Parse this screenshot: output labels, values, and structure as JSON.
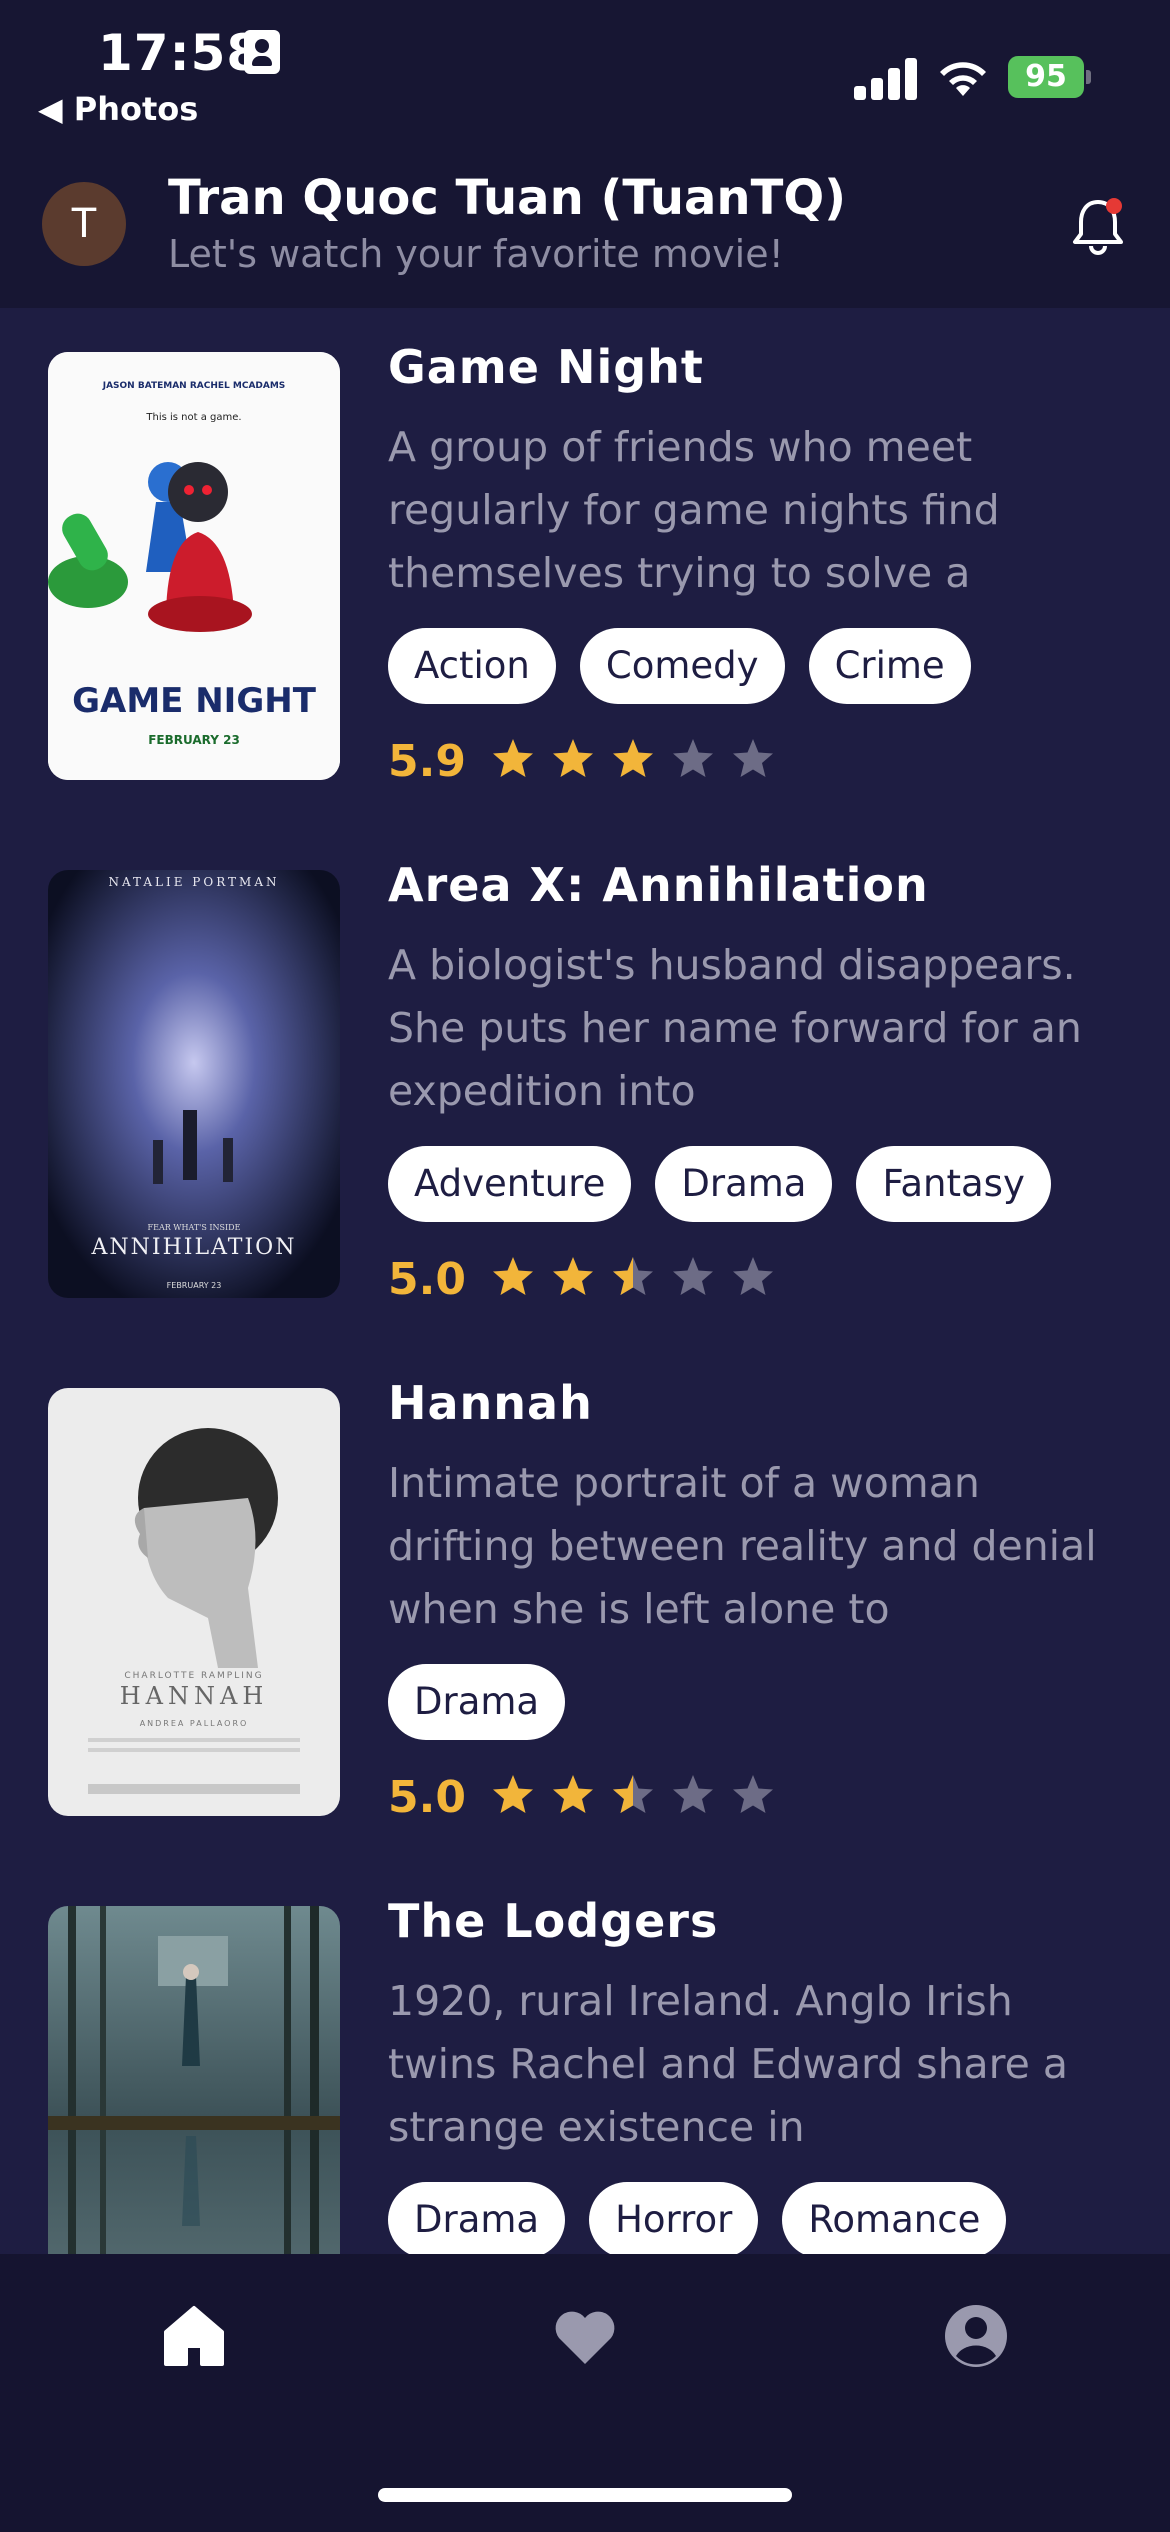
{
  "status_bar": {
    "time": "17:58",
    "back_label": "◀ Photos",
    "battery": "95"
  },
  "header": {
    "avatar_initial": "T",
    "user_name": "Tran Quoc Tuan (TuanTQ)",
    "subtitle": "Let's watch your favorite movie!"
  },
  "movies": [
    {
      "title": "Game Night",
      "description": "A group of friends who meet regularly for game nights find themselves trying to solve a",
      "genres": [
        "Action",
        "Comedy",
        "Crime"
      ],
      "rating": "5.9",
      "stars": 3
    },
    {
      "title": "Area X: Annihilation",
      "description": "A biologist's husband disappears. She puts her name forward for an expedition into",
      "genres": [
        "Adventure",
        "Drama",
        "Fantasy"
      ],
      "rating": "5.0",
      "stars": 2.5
    },
    {
      "title": "Hannah",
      "description": "Intimate portrait of a woman drifting between reality and denial when she is left alone to",
      "genres": [
        "Drama"
      ],
      "rating": "5.0",
      "stars": 2.5
    },
    {
      "title": "The Lodgers",
      "description": "1920, rural Ireland. Anglo Irish twins Rachel and Edward share a strange existence in",
      "genres": [
        "Drama",
        "Horror",
        "Romance"
      ],
      "rating": "",
      "stars": 0
    }
  ],
  "posters": [
    {
      "top": "JASON BATEMAN    RACHEL MCADAMS",
      "tag": "This is not a game.",
      "main": "GAME NIGHT",
      "date": "FEBRUARY 23"
    },
    {
      "top": "NATALIE PORTMAN",
      "tag": "FEAR WHAT'S INSIDE",
      "main": "ANNIHILATION",
      "date": "FEBRUARY 23"
    },
    {
      "top": "",
      "tag": "CHARLOTTE RAMPLING",
      "main": "HANNAH",
      "date": "ANDREA PALLAORO"
    },
    {
      "top": "",
      "tag": "",
      "main": "",
      "date": ""
    }
  ],
  "colors": {
    "background": "#1e1d42",
    "header": "#171633",
    "star": "#f2b53a",
    "star_empty": "#6d6c86",
    "notification_dot": "#e53935"
  },
  "tabs": [
    {
      "icon": "home-icon",
      "active": true
    },
    {
      "icon": "heart-icon",
      "active": false
    },
    {
      "icon": "profile-icon",
      "active": false
    }
  ]
}
